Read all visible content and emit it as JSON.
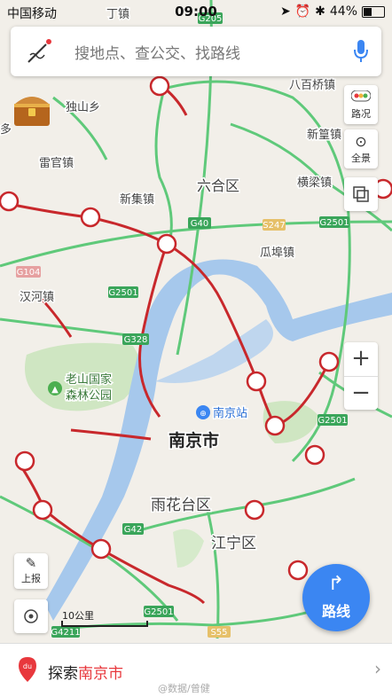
{
  "status_bar": {
    "carrier": "中国移动",
    "time": "09:00",
    "battery": "44%",
    "battery_level": 0.44
  },
  "search": {
    "placeholder": "搜地点、查公交、找路线",
    "logo_icon": "pen-logo-icon",
    "mic_icon": "microphone-icon"
  },
  "right_controls": {
    "traffic_label": "路况",
    "panorama_label": "全景",
    "layers_icon": "layers-icon"
  },
  "zoom": {
    "in": "+",
    "out": "−"
  },
  "left_controls": {
    "report_label": "上报",
    "locate_icon": "locate-icon"
  },
  "route_button": {
    "label": "路线"
  },
  "scale_label": "10公里",
  "bottom_bar": {
    "prefix": "探索",
    "city": "南京市",
    "chevron": "›",
    "watermark": "@数据/曾健"
  },
  "map_labels": {
    "nanjing": "南京市",
    "liuhe": "六合区",
    "yuhuatai": "雨花台区",
    "jiangning": "江宁区",
    "station": "南京站",
    "park_line1": "老山国家",
    "park_line2": "森林公园",
    "dushan": "独山乡",
    "leiguan": "雷官镇",
    "xinji": "新集镇",
    "hanhe": "汉河镇",
    "babaiqiao": "八百桥镇",
    "xinhuang": "新篁镇",
    "hengliang": "横梁镇",
    "guabu": "瓜埠镇",
    "ding": "丁镇",
    "duo": "多"
  },
  "road_shields": {
    "g205": "G205",
    "g40": "G40",
    "s247": "S247",
    "g2501_a": "G2501",
    "g2501_b": "G2501",
    "g2501_c": "G2501",
    "g2501_d": "G2501",
    "g328": "G328",
    "g42": "G42",
    "g4211": "G4211",
    "s55": "S55",
    "g104": "G104"
  },
  "colors": {
    "accent_blue": "#3b86f2",
    "traffic_red": "#c8282c",
    "road_green": "#5fc97a",
    "river": "#a6c8ec"
  }
}
